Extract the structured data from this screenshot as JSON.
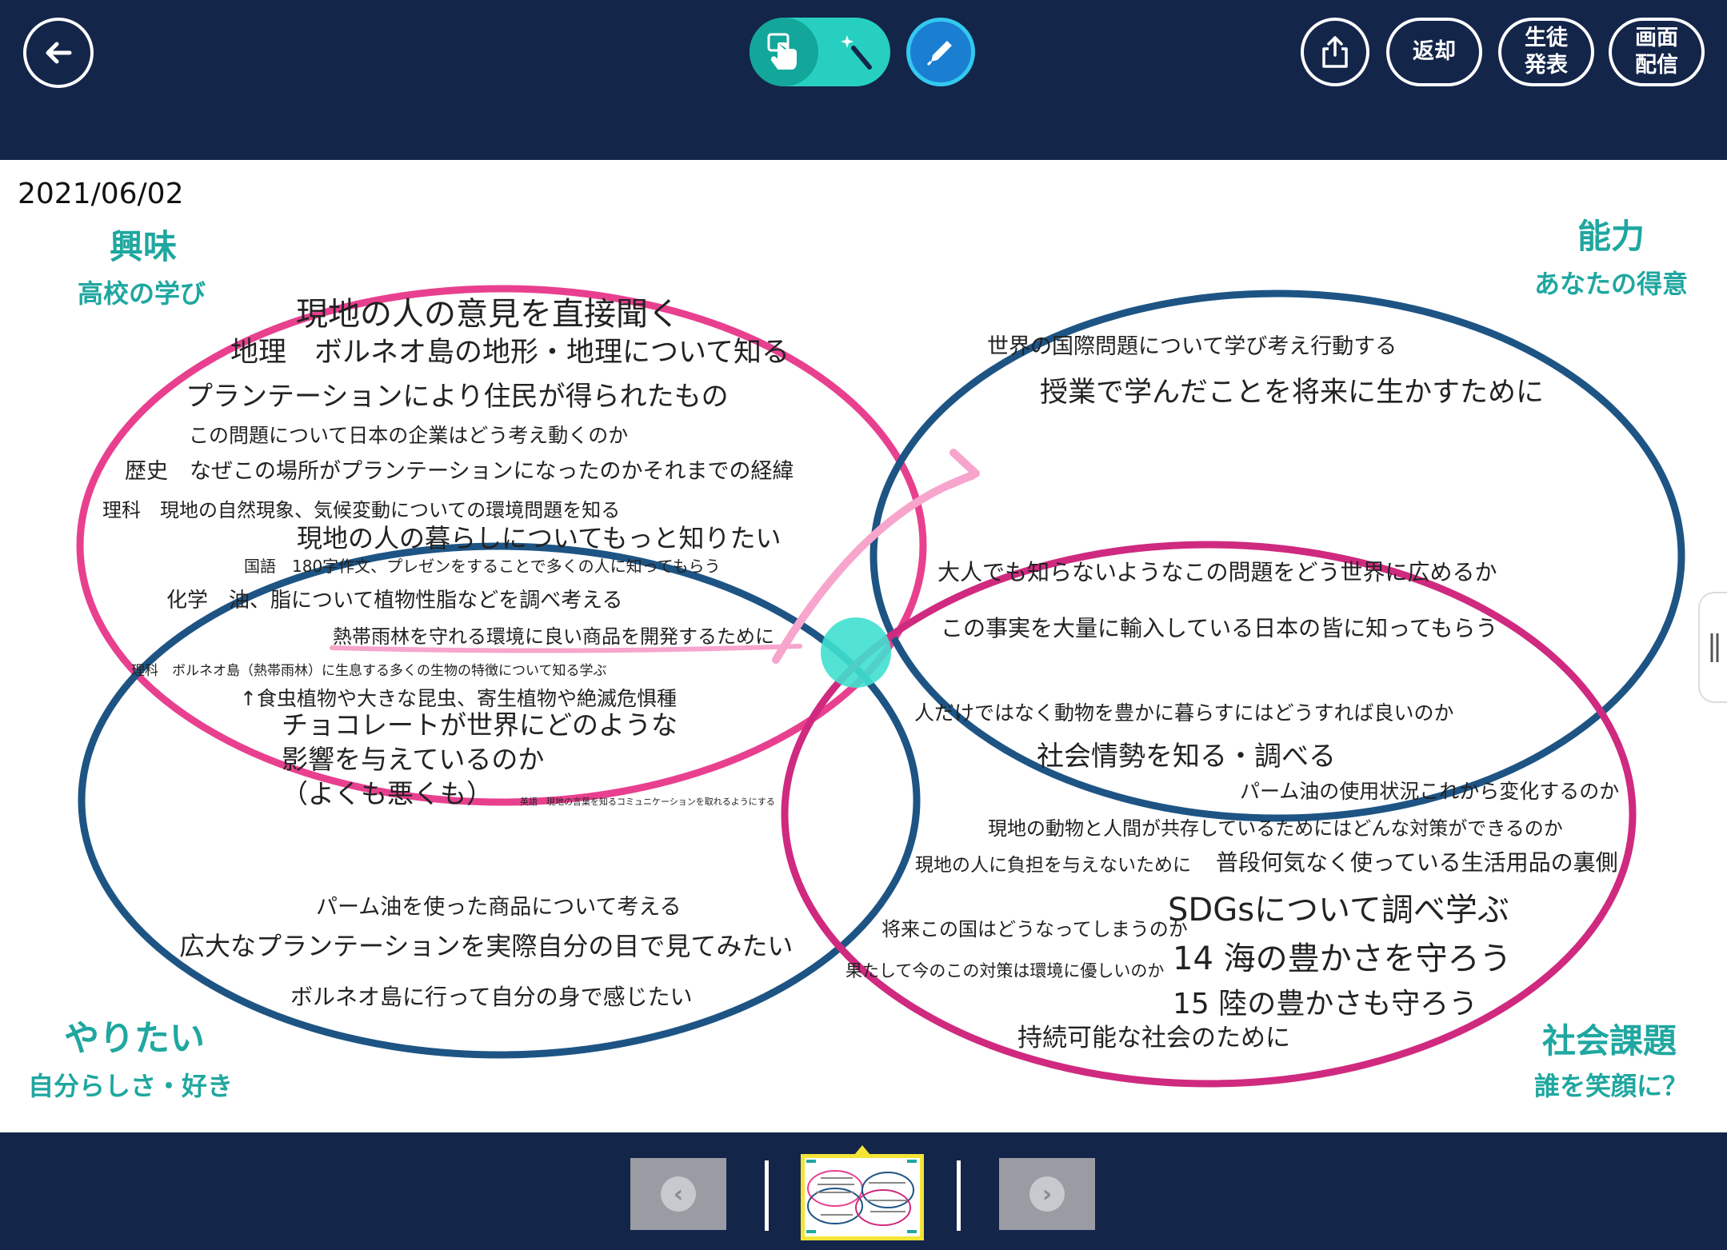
{
  "header": {
    "back_icon": "arrow-left-icon",
    "mode_toggle": {
      "touch_icon": "hand-touch-icon",
      "wand_icon": "magic-wand-icon"
    },
    "pen_icon": "pen-icon",
    "share_icon": "share-icon",
    "return_label": "返却",
    "present_label": "生徒\n発表",
    "screen_share_label": "画面\n配信"
  },
  "canvas": {
    "date": "2021/06/02",
    "quadrants": {
      "top_left": {
        "title": "興味",
        "subtitle": "高校の学び"
      },
      "top_right": {
        "title": "能力",
        "subtitle": "あなたの得意"
      },
      "bottom_left": {
        "title": "やりたい",
        "subtitle": "自分らしさ・好き"
      },
      "bottom_right": {
        "title": "社会課題",
        "subtitle": "誰を笑顔に？"
      }
    },
    "notes": {
      "n1": "現地の人の意見を直接聞く",
      "n2": "地理　ボルネオ島の地形・地理について知る",
      "n3": "プランテーションにより住民が得られたもの",
      "n4": "この問題について日本の企業はどう考え動くのか",
      "n5": "歴史　なぜこの場所がプランテーションになったのかそれまでの経緯",
      "n6": "理科　現地の自然現象、気候変動についての環境問題を知る",
      "n7": "現地の人の暮らしについてもっと知りたい",
      "n8": "国語　180字作文、プレゼンをすることで多くの人に知ってもらう",
      "n9": "化学　油、脂について植物性脂などを調べ考える",
      "n10": "熱帯雨林を守れる環境に良い商品を開発するために",
      "n11": "理科　ボルネオ島（熱帯雨林）に生息する多くの生物の特徴について知る学ぶ",
      "n12": "↑食虫植物や大きな昆虫、寄生植物や絶滅危惧種",
      "n13": "チョコレートが世界にどのような",
      "n14": "影響を与えているのか",
      "n15": "（よくも悪くも）",
      "n16": "英語　現地の言葉を知るコミュニケーションを取れるようにする",
      "n17": "パーム油を使った商品について考える",
      "n18": "広大なプランテーションを実際自分の目で見てみたい",
      "n19": "ボルネオ島に行って自分の身で感じたい",
      "n20": "世界の国際問題について学び考え行動する",
      "n21": "授業で学んだことを将来に生かすために",
      "n22": "大人でも知らないようなこの問題をどう世界に広めるか",
      "n23": "この事実を大量に輸入している日本の皆に知ってもらう",
      "n24": "人だけではなく動物を豊かに暮らすにはどうすれば良いのか",
      "n25": "社会情勢を知る・調べる",
      "n26": "パーム油の使用状況これから変化するのか",
      "n27": "現地の動物と人間が共存しているためにはどんな対策ができるのか",
      "n28": "現地の人に負担を与えないために",
      "n29": "普段何気なく使っている生活用品の裏側",
      "n30": "SDGsについて調べ学ぶ",
      "n31": "将来この国はどうなってしまうのか",
      "n32": "14 海の豊かさを守ろう",
      "n33": "果たして今のこの対策は環境に優しいのか",
      "n34": "15 陸の豊かさも守ろう",
      "n35": "持続可能な社会のために"
    },
    "colors": {
      "pink": "#e8408f",
      "navy": "#1d5484",
      "magenta": "#cf2a7f",
      "teal": "#1fa7a0",
      "highlight": "#3fe0cf"
    }
  },
  "footer": {
    "prev_icon": "chevron-left-icon",
    "next_icon": "chevron-right-icon",
    "thumbnail": "page-thumbnail"
  }
}
